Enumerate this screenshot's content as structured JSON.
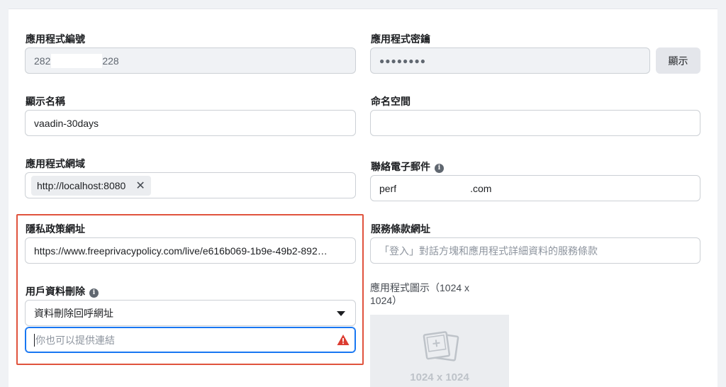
{
  "form": {
    "app_id": {
      "label": "應用程式編號",
      "value_prefix": "282",
      "value_suffix": "228"
    },
    "app_secret": {
      "label": "應用程式密鑰",
      "value": "●●●●●●●●",
      "show_button": "顯示"
    },
    "display_name": {
      "label": "顯示名稱",
      "value": "vaadin-30days"
    },
    "namespace": {
      "label": "命名空間",
      "value": ""
    },
    "app_domains": {
      "label": "應用程式網域",
      "chips": [
        "http://localhost:8080"
      ],
      "remove_glyph": "✕"
    },
    "contact_email": {
      "label": "聯絡電子郵件",
      "value_prefix": "perf",
      "value_suffix": ".com"
    },
    "privacy_url": {
      "label": "隱私政策網址",
      "value": "https://www.freeprivacypolicy.com/live/e616b069-1b9e-49b2-892…"
    },
    "terms_url": {
      "label": "服務條款網址",
      "placeholder": "「登入」對話方塊和應用程式詳細資料的服務條款"
    },
    "data_deletion": {
      "label": "用戶資料刪除",
      "selected_option": "資料刪除回呼網址",
      "input_placeholder": "你也可以提供連結"
    },
    "app_icon": {
      "label_line1": "應用程式圖示（1024 x",
      "label_line2": "1024）",
      "size_text": "1024 x 1024"
    }
  },
  "colors": {
    "highlight_border": "#e0533d",
    "warning": "#dc3c31",
    "focus_border": "#1877f2"
  },
  "icons": {
    "info": "info-icon",
    "warning": "warning-icon",
    "close": "close-icon",
    "dropdown": "chevron-down-icon",
    "image_placeholder": "image-placeholder-icon"
  }
}
